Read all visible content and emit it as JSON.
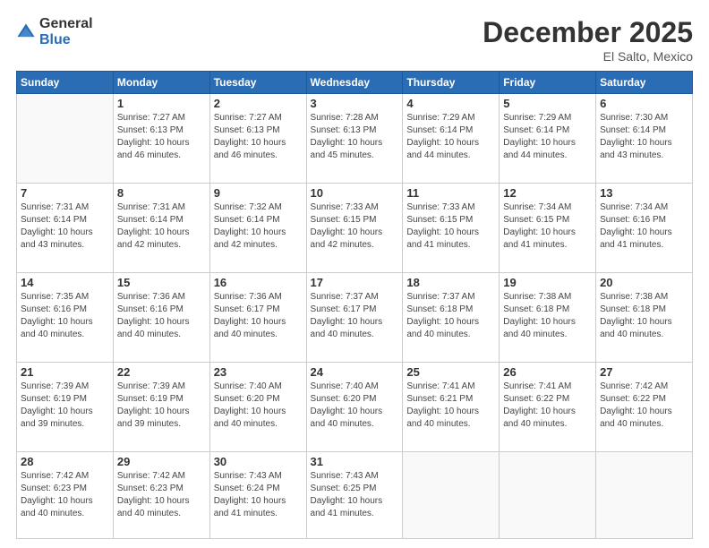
{
  "logo": {
    "general": "General",
    "blue": "Blue"
  },
  "header": {
    "month": "December 2025",
    "location": "El Salto, Mexico"
  },
  "weekdays": [
    "Sunday",
    "Monday",
    "Tuesday",
    "Wednesday",
    "Thursday",
    "Friday",
    "Saturday"
  ],
  "weeks": [
    [
      {
        "day": "",
        "info": ""
      },
      {
        "day": "1",
        "info": "Sunrise: 7:27 AM\nSunset: 6:13 PM\nDaylight: 10 hours\nand 46 minutes."
      },
      {
        "day": "2",
        "info": "Sunrise: 7:27 AM\nSunset: 6:13 PM\nDaylight: 10 hours\nand 46 minutes."
      },
      {
        "day": "3",
        "info": "Sunrise: 7:28 AM\nSunset: 6:13 PM\nDaylight: 10 hours\nand 45 minutes."
      },
      {
        "day": "4",
        "info": "Sunrise: 7:29 AM\nSunset: 6:14 PM\nDaylight: 10 hours\nand 44 minutes."
      },
      {
        "day": "5",
        "info": "Sunrise: 7:29 AM\nSunset: 6:14 PM\nDaylight: 10 hours\nand 44 minutes."
      },
      {
        "day": "6",
        "info": "Sunrise: 7:30 AM\nSunset: 6:14 PM\nDaylight: 10 hours\nand 43 minutes."
      }
    ],
    [
      {
        "day": "7",
        "info": "Sunrise: 7:31 AM\nSunset: 6:14 PM\nDaylight: 10 hours\nand 43 minutes."
      },
      {
        "day": "8",
        "info": "Sunrise: 7:31 AM\nSunset: 6:14 PM\nDaylight: 10 hours\nand 42 minutes."
      },
      {
        "day": "9",
        "info": "Sunrise: 7:32 AM\nSunset: 6:14 PM\nDaylight: 10 hours\nand 42 minutes."
      },
      {
        "day": "10",
        "info": "Sunrise: 7:33 AM\nSunset: 6:15 PM\nDaylight: 10 hours\nand 42 minutes."
      },
      {
        "day": "11",
        "info": "Sunrise: 7:33 AM\nSunset: 6:15 PM\nDaylight: 10 hours\nand 41 minutes."
      },
      {
        "day": "12",
        "info": "Sunrise: 7:34 AM\nSunset: 6:15 PM\nDaylight: 10 hours\nand 41 minutes."
      },
      {
        "day": "13",
        "info": "Sunrise: 7:34 AM\nSunset: 6:16 PM\nDaylight: 10 hours\nand 41 minutes."
      }
    ],
    [
      {
        "day": "14",
        "info": "Sunrise: 7:35 AM\nSunset: 6:16 PM\nDaylight: 10 hours\nand 40 minutes."
      },
      {
        "day": "15",
        "info": "Sunrise: 7:36 AM\nSunset: 6:16 PM\nDaylight: 10 hours\nand 40 minutes."
      },
      {
        "day": "16",
        "info": "Sunrise: 7:36 AM\nSunset: 6:17 PM\nDaylight: 10 hours\nand 40 minutes."
      },
      {
        "day": "17",
        "info": "Sunrise: 7:37 AM\nSunset: 6:17 PM\nDaylight: 10 hours\nand 40 minutes."
      },
      {
        "day": "18",
        "info": "Sunrise: 7:37 AM\nSunset: 6:18 PM\nDaylight: 10 hours\nand 40 minutes."
      },
      {
        "day": "19",
        "info": "Sunrise: 7:38 AM\nSunset: 6:18 PM\nDaylight: 10 hours\nand 40 minutes."
      },
      {
        "day": "20",
        "info": "Sunrise: 7:38 AM\nSunset: 6:18 PM\nDaylight: 10 hours\nand 40 minutes."
      }
    ],
    [
      {
        "day": "21",
        "info": "Sunrise: 7:39 AM\nSunset: 6:19 PM\nDaylight: 10 hours\nand 39 minutes."
      },
      {
        "day": "22",
        "info": "Sunrise: 7:39 AM\nSunset: 6:19 PM\nDaylight: 10 hours\nand 39 minutes."
      },
      {
        "day": "23",
        "info": "Sunrise: 7:40 AM\nSunset: 6:20 PM\nDaylight: 10 hours\nand 40 minutes."
      },
      {
        "day": "24",
        "info": "Sunrise: 7:40 AM\nSunset: 6:20 PM\nDaylight: 10 hours\nand 40 minutes."
      },
      {
        "day": "25",
        "info": "Sunrise: 7:41 AM\nSunset: 6:21 PM\nDaylight: 10 hours\nand 40 minutes."
      },
      {
        "day": "26",
        "info": "Sunrise: 7:41 AM\nSunset: 6:22 PM\nDaylight: 10 hours\nand 40 minutes."
      },
      {
        "day": "27",
        "info": "Sunrise: 7:42 AM\nSunset: 6:22 PM\nDaylight: 10 hours\nand 40 minutes."
      }
    ],
    [
      {
        "day": "28",
        "info": "Sunrise: 7:42 AM\nSunset: 6:23 PM\nDaylight: 10 hours\nand 40 minutes."
      },
      {
        "day": "29",
        "info": "Sunrise: 7:42 AM\nSunset: 6:23 PM\nDaylight: 10 hours\nand 40 minutes."
      },
      {
        "day": "30",
        "info": "Sunrise: 7:43 AM\nSunset: 6:24 PM\nDaylight: 10 hours\nand 41 minutes."
      },
      {
        "day": "31",
        "info": "Sunrise: 7:43 AM\nSunset: 6:25 PM\nDaylight: 10 hours\nand 41 minutes."
      },
      {
        "day": "",
        "info": ""
      },
      {
        "day": "",
        "info": ""
      },
      {
        "day": "",
        "info": ""
      }
    ]
  ]
}
